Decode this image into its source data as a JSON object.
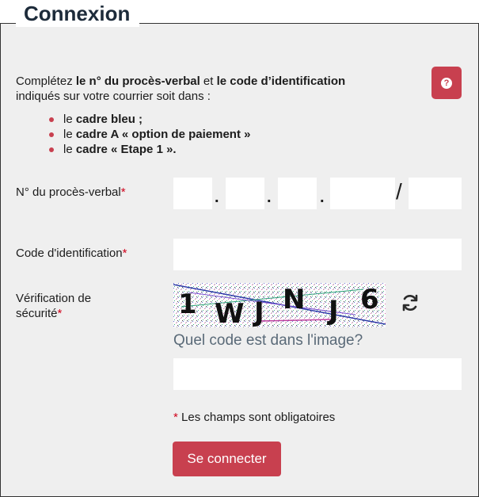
{
  "form": {
    "title": "Connexion",
    "intro": {
      "p1": "Complétez ",
      "b1": "le n° du procès-verbal",
      "p2": " et ",
      "b2": "le code d’identification",
      "p3": "indiqués sur votre courrier soit dans :"
    },
    "bullets": [
      {
        "pre": "le ",
        "bold": "cadre bleu ;"
      },
      {
        "pre": "le ",
        "bold": "cadre A « option de paiement »"
      },
      {
        "pre": "le ",
        "bold": "cadre « Etape 1 »."
      }
    ],
    "help_icon": "question-circle-icon",
    "pv_label": "N° du procès-verbal",
    "pv_separators": [
      ".",
      ".",
      ".",
      "/"
    ],
    "code_label": "Code d'identification",
    "security_label_1": "Vérification de",
    "security_label_2": "sécurité",
    "required_mark": "*",
    "captcha_chars": [
      "1",
      "W",
      "J",
      "N",
      "J",
      "6"
    ],
    "captcha_question": "Quel code est dans l'image?",
    "refresh_icon": "refresh-icon",
    "mandatory_note": " Les champs sont obligatoires",
    "submit_label": "Se connecter"
  },
  "colors": {
    "accent": "#c8404f",
    "title": "#1d2b3a",
    "panel": "#efefef"
  }
}
